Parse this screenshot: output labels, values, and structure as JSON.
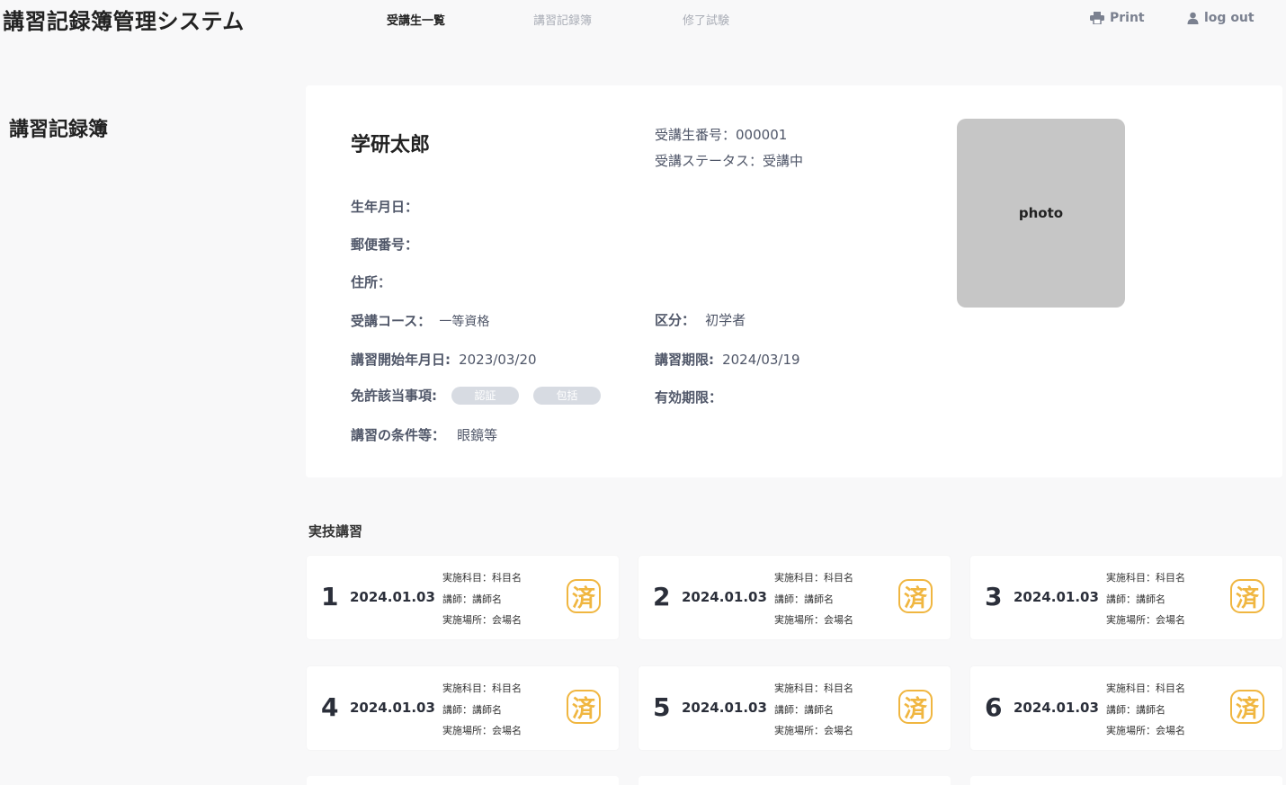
{
  "header": {
    "app_title": "講習記録簿管理システム",
    "nav": [
      "受講生一覧",
      "講習記録簿",
      "修了試験"
    ],
    "print_label": "Print",
    "logout_label": "log out"
  },
  "page_heading": "講習記録簿",
  "profile": {
    "name": "学研太郎",
    "student_number_label": "受講生番号：",
    "student_number": "000001",
    "status_label": "受講ステータス：",
    "status": "受講中",
    "birthdate_label": "生年月日：",
    "postal_label": "郵便番号：",
    "address_label": "住所：",
    "course_label": "受講コース：",
    "course": "一等資格",
    "category_label": "区分：",
    "category": "初学者",
    "start_label": "講習開始年月日:",
    "start_date": "2023/03/20",
    "deadline_label": "講習期限:",
    "deadline": "2024/03/19",
    "license_label": "免許該当事項:",
    "license_badges": [
      "認証",
      "包括"
    ],
    "validity_label": "有効期限：",
    "conditions_label": "講習の条件等：",
    "conditions": "眼鏡等",
    "photo_label": "photo"
  },
  "practical": {
    "title": "実技講習",
    "sessions": [
      {
        "no": "1",
        "date": "2024.01.03",
        "subject": "実施科目：科目名",
        "instructor": "講師：講師名",
        "place": "実施場所：会場名",
        "stamp": "済"
      },
      {
        "no": "2",
        "date": "2024.01.03",
        "subject": "実施科目：科目名",
        "instructor": "講師：講師名",
        "place": "実施場所：会場名",
        "stamp": "済"
      },
      {
        "no": "3",
        "date": "2024.01.03",
        "subject": "実施科目：科目名",
        "instructor": "講師：講師名",
        "place": "実施場所：会場名",
        "stamp": "済"
      },
      {
        "no": "4",
        "date": "2024.01.03",
        "subject": "実施科目：科目名",
        "instructor": "講師：講師名",
        "place": "実施場所：会場名",
        "stamp": "済"
      },
      {
        "no": "5",
        "date": "2024.01.03",
        "subject": "実施科目：科目名",
        "instructor": "講師：講師名",
        "place": "実施場所：会場名",
        "stamp": "済"
      },
      {
        "no": "6",
        "date": "2024.01.03",
        "subject": "実施科目：科目名",
        "instructor": "講師：講師名",
        "place": "実施場所：会場名",
        "stamp": "済"
      }
    ]
  },
  "icons": {
    "print": "printer-icon",
    "logout": "user-icon"
  }
}
